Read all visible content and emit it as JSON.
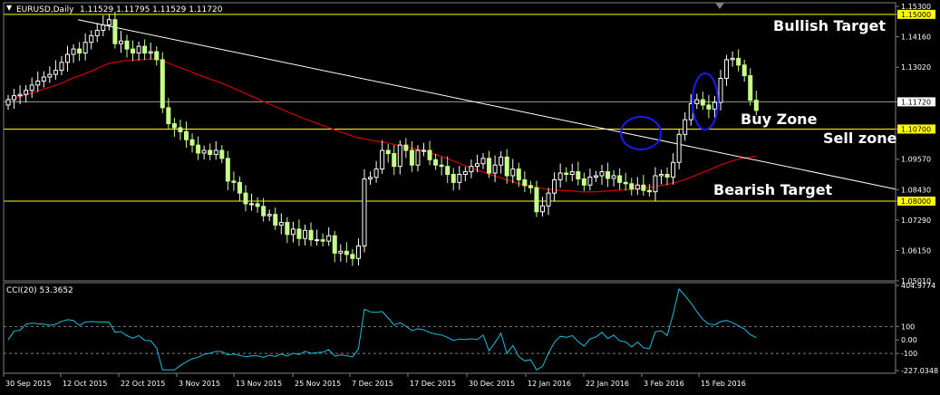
{
  "header": {
    "menu_arrow": "▼",
    "symbol": "EURUSD,Daily",
    "ohlc": "1.11529 1.11795 1.11529 1.11720"
  },
  "annotations": {
    "bullish": "Bullish Target",
    "buy": "Buy Zone",
    "sell": "Sell zone",
    "bearish": "Bearish Target"
  },
  "price_labels": [
    "1.15300",
    "1.15000",
    "1.14160",
    "1.13020",
    "1.11720",
    "1.10700",
    "1.09570",
    "1.08430",
    "1.08000",
    "1.07290",
    "1.06150",
    "1.05010"
  ],
  "cci": {
    "label": "CCI(20) 53.3652",
    "levels": [
      "404.9774",
      "100",
      "0.00",
      "-100",
      "-227.0348"
    ]
  },
  "dates": [
    "30 Sep 2015",
    "12 Oct 2015",
    "22 Oct 2015",
    "3 Nov 2015",
    "13 Nov 2015",
    "25 Nov 2015",
    "7 Dec 2015",
    "17 Dec 2015",
    "30 Dec 2015",
    "12 Jan 2016",
    "22 Jan 2016",
    "3 Feb 2016",
    "15 Feb 2016"
  ],
  "colors": {
    "background": "#000000",
    "bull_candle": "#ffffff",
    "bear_candle": "#c8ff8c",
    "moving_average": "#c80000",
    "trendline": "#ffffff",
    "level_lines": "#ffff00",
    "cci_line": "#1ebdde",
    "circles": "#1a1aff"
  },
  "chart_data": {
    "type": "candlestick",
    "symbol": "EURUSD",
    "timeframe": "Daily",
    "ylim": [
      1.0501,
      1.153
    ],
    "levels": {
      "bullish_target": 1.15,
      "buy_zone": 1.1172,
      "sell_zone": 1.107,
      "bearish_target": 1.08
    },
    "closes": [
      1.118,
      1.1195,
      1.12,
      1.1215,
      1.1235,
      1.125,
      1.1265,
      1.1275,
      1.129,
      1.132,
      1.135,
      1.137,
      1.1355,
      1.1395,
      1.142,
      1.144,
      1.146,
      1.148,
      1.139,
      1.14,
      1.137,
      1.1355,
      1.138,
      1.1355,
      1.136,
      1.133,
      1.115,
      1.109,
      1.1075,
      1.106,
      1.103,
      1.101,
      1.098,
      1.099,
      1.0975,
      1.099,
      1.096,
      1.0875,
      1.087,
      1.083,
      1.079,
      1.079,
      1.078,
      1.0745,
      1.075,
      1.071,
      1.072,
      1.0675,
      1.0695,
      1.066,
      1.069,
      1.0655,
      1.0655,
      1.065,
      1.067,
      1.0605,
      1.0612,
      1.06,
      1.0585,
      1.0632,
      1.0883,
      1.0889,
      1.092,
      1.099,
      1.0978,
      1.093,
      1.101,
      1.099,
      1.0935,
      1.099,
      1.099,
      1.0955,
      1.0935,
      1.093,
      1.09,
      1.087,
      1.09,
      1.091,
      1.093,
      1.094,
      1.096,
      1.0905,
      1.0935,
      1.0965,
      1.0895,
      1.092,
      1.088,
      1.0858,
      1.085,
      1.076,
      1.0782,
      1.083,
      1.088,
      1.0905,
      1.09,
      1.091,
      1.0883,
      1.086,
      1.089,
      1.0895,
      1.091,
      1.0885,
      1.0895,
      1.087,
      1.0865,
      1.0845,
      1.086,
      1.084,
      1.0835,
      1.0895,
      1.09,
      1.089,
      1.0945,
      1.105,
      1.1105,
      1.1165,
      1.118,
      1.116,
      1.1145,
      1.117,
      1.126,
      1.133,
      1.1335,
      1.131,
      1.127,
      1.1178,
      1.114
    ],
    "cci_range": [
      -227.0348,
      404.9774
    ],
    "cci_levels": [
      100,
      0,
      -100
    ],
    "cci_last": 53.3652,
    "x_tick_labels": [
      "30 Sep 2015",
      "12 Oct 2015",
      "22 Oct 2015",
      "3 Nov 2015",
      "13 Nov 2015",
      "25 Nov 2015",
      "7 Dec 2015",
      "17 Dec 2015",
      "30 Dec 2015",
      "12 Jan 2016",
      "22 Jan 2016",
      "3 Feb 2016",
      "15 Feb 2016"
    ]
  }
}
